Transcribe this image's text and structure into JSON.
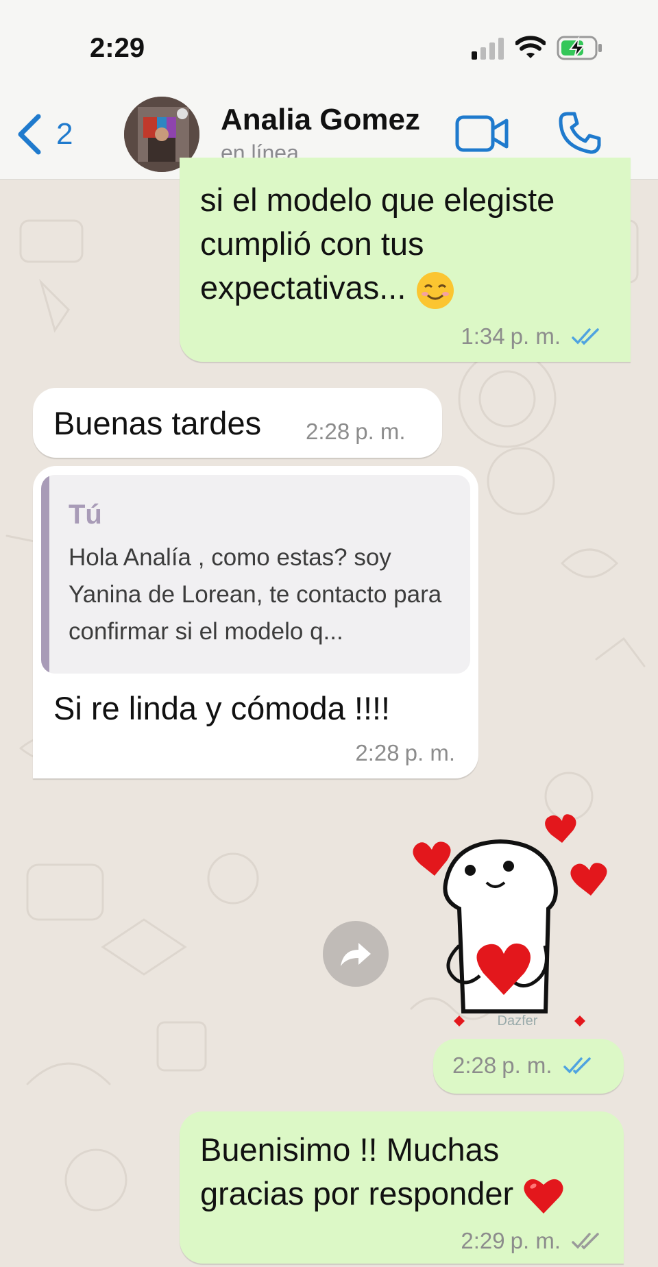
{
  "status_bar": {
    "time": "2:29"
  },
  "header": {
    "back_count": "2",
    "contact_name": "Analia Gomez",
    "contact_status": "en línea"
  },
  "messages": [
    {
      "direction": "outgoing",
      "text": "si el modelo que elegiste cumplió con tus expectativas...",
      "emoji": "smiling-face-icon",
      "time": "1:34",
      "ampm": "p. m.",
      "status": "read"
    },
    {
      "direction": "incoming",
      "text": "Buenas tardes",
      "time": "2:28",
      "ampm": "p. m."
    },
    {
      "direction": "incoming",
      "quote": {
        "author": "Tú",
        "text": "Hola Analía , como estas? soy Yanina de Lorean, te contacto para confirmar si el modelo q..."
      },
      "text": "Si re linda y cómoda !!!!",
      "time": "2:28",
      "ampm": "p. m."
    },
    {
      "direction": "outgoing",
      "type": "sticker",
      "sticker_caption": "Dazfer",
      "time": "2:28",
      "ampm": "p. m.",
      "status": "read"
    },
    {
      "direction": "outgoing",
      "text": "Buenisimo !! Muchas gracias por responder",
      "emoji": "red-heart-icon",
      "time": "2:29",
      "ampm": "p. m.",
      "status": "delivered"
    }
  ],
  "colors": {
    "accent": "#1F7ACD",
    "outgoing_bubble": "#DCF8C6",
    "incoming_bubble": "#FFFFFF",
    "read_ticks": "#4FA3E0",
    "quote_accent": "#A89BB7"
  }
}
